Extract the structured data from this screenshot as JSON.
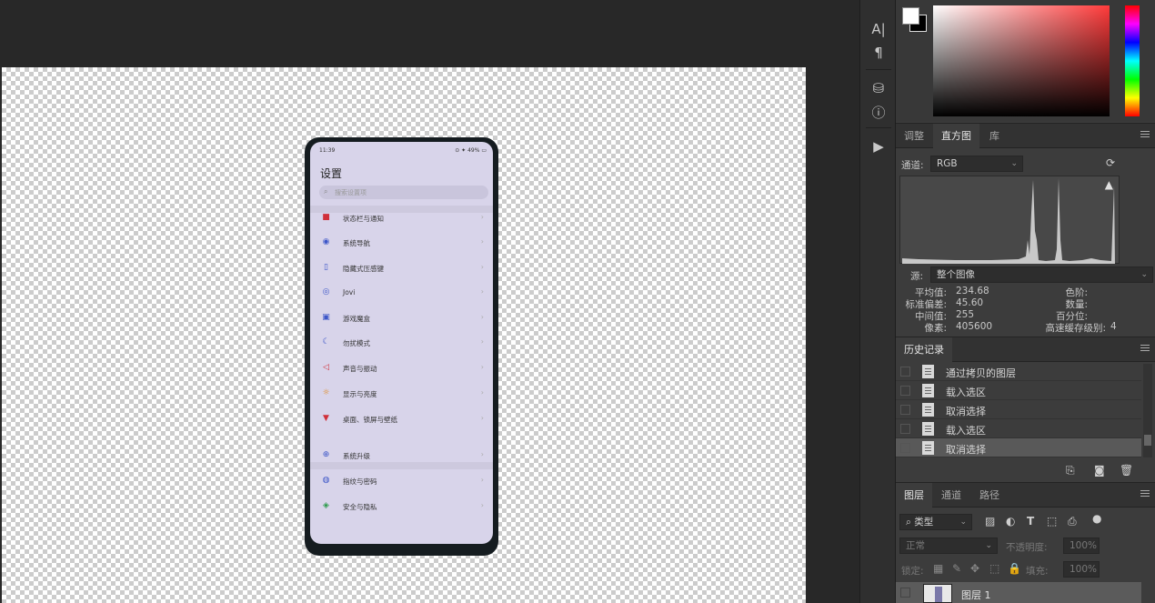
{
  "phone": {
    "time": "11:39",
    "status_right": "⊙ ✦ 49% ▭",
    "title": "设置",
    "search_placeholder": "搜索设置项",
    "items": [
      {
        "label": "状态栏与通知",
        "icon": "■",
        "color": "#d0303a"
      },
      {
        "label": "系统导航",
        "icon": "◉",
        "color": "#3d56c8"
      },
      {
        "label": "隐藏式压感键",
        "icon": "▯",
        "color": "#3d56c8"
      },
      {
        "label": "Jovi",
        "icon": "◎",
        "color": "#3d56c8"
      },
      {
        "label": "游戏魔盒",
        "icon": "▣",
        "color": "#3d56c8"
      },
      {
        "label": "勿扰模式",
        "icon": "☾",
        "color": "#3d56c8"
      },
      {
        "label": "声音与振动",
        "icon": "◁",
        "color": "#d0303a"
      },
      {
        "label": "显示与亮度",
        "icon": "☼",
        "color": "#e08a20"
      },
      {
        "label": "桌面、锁屏与壁纸",
        "icon": "▼",
        "color": "#d0303a"
      },
      {
        "label": "系统升级",
        "icon": "⊕",
        "color": "#3d56c8"
      },
      {
        "label": "指纹与密码",
        "icon": "◍",
        "color": "#3d56c8"
      },
      {
        "label": "安全与隐私",
        "icon": "◈",
        "color": "#2a9a4a"
      }
    ]
  },
  "tools": [
    "A|",
    "¶",
    "⛁",
    "ⓘ",
    "▶"
  ],
  "adjust_panel": {
    "tabs": [
      "调整",
      "直方图",
      "库"
    ],
    "active_tab": "直方图",
    "channel_label": "通道:",
    "channel_value": "RGB",
    "source_label": "源:",
    "source_value": "整个图像",
    "stats": {
      "mean_label": "平均值:",
      "mean": "234.68",
      "std_label": "标准偏差:",
      "std": "45.60",
      "median_label": "中间值:",
      "median": "255",
      "pixels_label": "像素:",
      "pixels": "405600",
      "level_label": "色阶:",
      "count_label": "数量:",
      "percent_label": "百分位:",
      "cache_label": "高速缓存级别:",
      "cache": "4"
    }
  },
  "history_panel": {
    "title": "历史记录",
    "items": [
      "通过拷贝的图层",
      "载入选区",
      "取消选择",
      "载入选区",
      "取消选择"
    ]
  },
  "layers_panel": {
    "tabs": [
      "图层",
      "通道",
      "路径"
    ],
    "filter_label": "类型",
    "blend_mode": "正常",
    "opacity_label": "不透明度:",
    "opacity_value": "100%",
    "lock_label": "锁定:",
    "fill_label": "填充:",
    "fill_value": "100%",
    "layer_name": "图层 1"
  }
}
